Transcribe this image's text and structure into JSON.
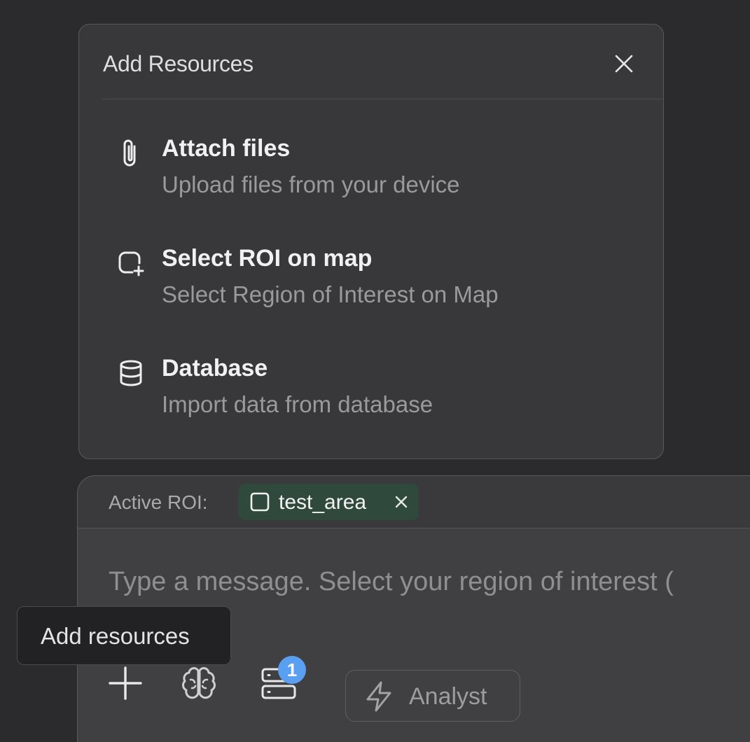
{
  "modal": {
    "title": "Add Resources",
    "close_icon": "close-icon",
    "options": [
      {
        "title": "Attach files",
        "description": "Upload files from your device",
        "icon": "paperclip-icon"
      },
      {
        "title": "Select ROI on map",
        "description": "Select Region of Interest on Map",
        "icon": "square-plus-icon"
      },
      {
        "title": "Database",
        "description": "Import data from database",
        "icon": "database-icon"
      }
    ]
  },
  "composer": {
    "roi_label": "Active ROI:",
    "roi_chip": {
      "name": "test_area",
      "icon": "square-icon",
      "remove_icon": "close-icon"
    },
    "message_placeholder": "Type a message. Select your region of interest (",
    "toolbar": {
      "add_icon": "plus-icon",
      "brain_icon": "brain-icon",
      "server_icon": "server-icon",
      "server_badge": "1",
      "mode_icon": "lightning-icon",
      "mode_label": "Analyst"
    }
  },
  "tooltip": {
    "text": "Add resources"
  },
  "colors": {
    "background": "#2b2b2d",
    "panel": "#38383a",
    "composer": "#404042",
    "chip": "#2f4a3c",
    "badge": "#5aa0f2"
  }
}
